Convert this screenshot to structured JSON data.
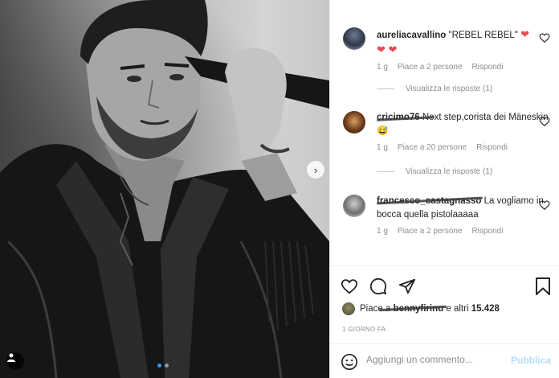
{
  "comments": [
    {
      "user": "aureliacavallino",
      "text": "\"REBEL REBEL\"",
      "hearts": "❤",
      "hearts_line2": "❤ ❤",
      "age": "1 g",
      "likes": "Piace a 2 persone",
      "reply": "Rispondi",
      "view_replies": "Visualizza le risposte (1)"
    },
    {
      "user": "cricimo76",
      "text": "Next step,corista dei Mäneskin",
      "emoji": "😅",
      "age": "1 g",
      "likes": "Piace a 20 persone",
      "reply": "Rispondi",
      "view_replies": "Visualizza le risposte (1)"
    },
    {
      "user": "francesco_castagnasso",
      "text": "La vogliamo in bocca quella pistolaaaaa",
      "age": "1 g",
      "likes": "Piace a 2 persone",
      "reply": "Rispondi"
    }
  ],
  "likes_summary": {
    "prefix": "Piace a",
    "user": "bennyfirinu",
    "middle": "e altri",
    "count": "15.428"
  },
  "date": "1 GIORNO FA",
  "add_comment": {
    "placeholder": "Aggiungi un commento...",
    "publish_label": "Pubblica"
  },
  "icons": {
    "like": "heart-outline-icon",
    "comment": "comment-bubble-icon",
    "share": "paper-plane-icon",
    "save": "bookmark-icon",
    "emoji": "smiley-icon",
    "next": "chevron-right-icon",
    "tag": "user-tag-icon"
  },
  "colors": {
    "heart_red": "#ed4956",
    "publish_disabled": "#b2dffc",
    "muted_text": "#8e8e8e",
    "carousel_active_dot": "#3897f0"
  }
}
